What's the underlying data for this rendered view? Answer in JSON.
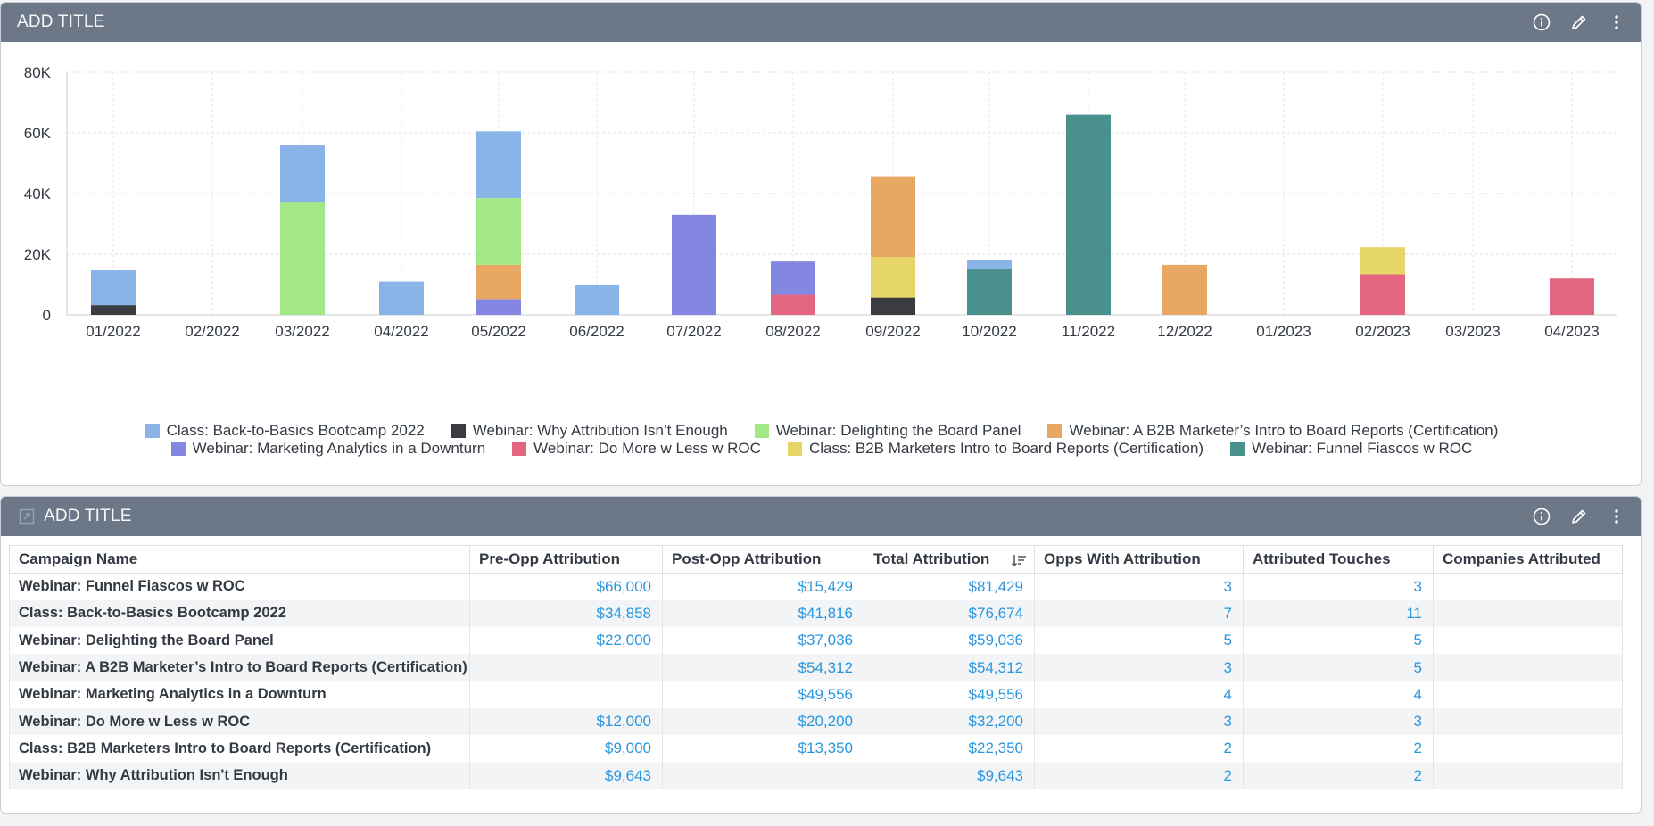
{
  "colors": {
    "header_bg": "#6c7887",
    "link_blue": "#2a96de",
    "series": [
      "#8ab4e8",
      "#3b3c42",
      "#a3e887",
      "#e9a764",
      "#8387e1",
      "#e2667f",
      "#e6d668",
      "#4a918e"
    ]
  },
  "top_panel": {
    "title": "ADD TITLE",
    "icons": [
      "info-icon",
      "pencil-icon",
      "kebab-menu-icon"
    ]
  },
  "chart_data": {
    "type": "bar",
    "stacked": true,
    "categories": [
      "01/2022",
      "02/2022",
      "03/2022",
      "04/2022",
      "05/2022",
      "06/2022",
      "07/2022",
      "08/2022",
      "09/2022",
      "10/2022",
      "11/2022",
      "12/2022",
      "01/2023",
      "02/2023",
      "03/2023",
      "04/2023"
    ],
    "ylim": [
      0,
      80000
    ],
    "yticks": [
      0,
      20000,
      40000,
      60000,
      80000
    ],
    "ytick_labels": [
      "0",
      "20K",
      "40K",
      "60K",
      "80K"
    ],
    "grid": true,
    "legend_position": "bottom",
    "series": [
      {
        "name": "Class: Back-to-Basics Bootcamp 2022",
        "values": [
          11500,
          0,
          19000,
          11000,
          22000,
          10000,
          0,
          0,
          0,
          3000,
          0,
          0,
          0,
          0,
          0,
          0
        ]
      },
      {
        "name": "Webinar: Why Attribution Isn’t Enough",
        "values": [
          3200,
          0,
          0,
          0,
          0,
          0,
          0,
          0,
          5700,
          0,
          0,
          0,
          0,
          0,
          0,
          0
        ]
      },
      {
        "name": "Webinar: Delighting the Board Panel",
        "values": [
          0,
          0,
          37000,
          0,
          22000,
          0,
          0,
          0,
          0,
          0,
          0,
          0,
          0,
          0,
          0,
          0
        ]
      },
      {
        "name": "Webinar: A B2B Marketer’s Intro to Board Reports (Certification)",
        "values": [
          0,
          0,
          0,
          0,
          11300,
          0,
          0,
          0,
          26600,
          0,
          0,
          16500,
          0,
          0,
          0,
          0
        ]
      },
      {
        "name": "Webinar: Marketing Analytics in a Downturn",
        "values": [
          0,
          0,
          0,
          0,
          5200,
          0,
          33000,
          11000,
          0,
          0,
          0,
          0,
          0,
          0,
          0,
          0
        ]
      },
      {
        "name": "Webinar: Do More w Less w ROC",
        "values": [
          0,
          0,
          0,
          0,
          0,
          0,
          0,
          6600,
          0,
          0,
          0,
          0,
          0,
          13400,
          0,
          12000
        ]
      },
      {
        "name": "Class: B2B Marketers Intro to Board Reports (Certification)",
        "values": [
          0,
          0,
          0,
          0,
          0,
          0,
          0,
          0,
          13400,
          0,
          0,
          0,
          0,
          8900,
          0,
          0
        ]
      },
      {
        "name": "Webinar: Funnel Fiascos w ROC",
        "values": [
          0,
          0,
          0,
          0,
          0,
          0,
          0,
          0,
          0,
          15000,
          66000,
          0,
          0,
          0,
          0,
          0
        ]
      }
    ]
  },
  "bottom_panel": {
    "title": "ADD TITLE",
    "icons": [
      "info-icon",
      "pencil-icon",
      "kebab-menu-icon"
    ],
    "table": {
      "columns": [
        "Campaign Name",
        "Pre-Opp Attribution",
        "Post-Opp Attribution",
        "Total Attribution",
        "Opps With Attribution",
        "Attributed Touches",
        "Companies Attributed"
      ],
      "sorted_column": "Total Attribution",
      "rows": [
        [
          "Webinar: Funnel Fiascos w ROC",
          "$66,000",
          "$15,429",
          "$81,429",
          "3",
          "3",
          ""
        ],
        [
          "Class: Back-to-Basics Bootcamp 2022",
          "$34,858",
          "$41,816",
          "$76,674",
          "7",
          "11",
          ""
        ],
        [
          "Webinar: Delighting the Board Panel",
          "$22,000",
          "$37,036",
          "$59,036",
          "5",
          "5",
          ""
        ],
        [
          "Webinar: A B2B Marketer’s Intro to Board Reports (Certification)",
          "",
          "$54,312",
          "$54,312",
          "3",
          "5",
          ""
        ],
        [
          "Webinar: Marketing Analytics in a Downturn",
          "",
          "$49,556",
          "$49,556",
          "4",
          "4",
          ""
        ],
        [
          "Webinar: Do More w Less w ROC",
          "$12,000",
          "$20,200",
          "$32,200",
          "3",
          "3",
          ""
        ],
        [
          "Class: B2B Marketers Intro to Board Reports (Certification)",
          "$9,000",
          "$13,350",
          "$22,350",
          "2",
          "2",
          ""
        ],
        [
          "Webinar: Why Attribution Isn't Enough",
          "$9,643",
          "",
          "$9,643",
          "2",
          "2",
          ""
        ]
      ]
    }
  }
}
